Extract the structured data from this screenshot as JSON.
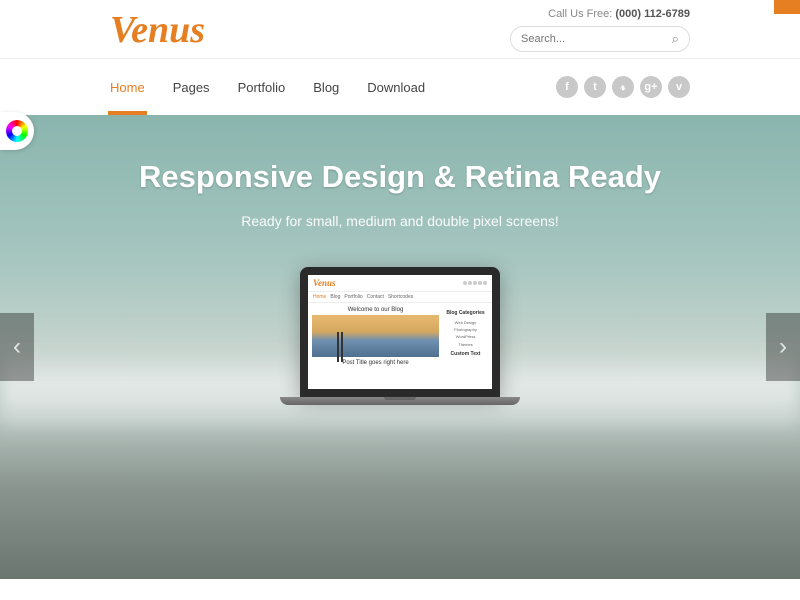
{
  "header": {
    "logo": "Venus",
    "call_label": "Call Us Free: ",
    "phone": "(000) 112-6789",
    "search_placeholder": "Search..."
  },
  "nav": {
    "items": [
      {
        "label": "Home",
        "active": true
      },
      {
        "label": "Pages",
        "active": false
      },
      {
        "label": "Portfolio",
        "active": false
      },
      {
        "label": "Blog",
        "active": false
      },
      {
        "label": "Download",
        "active": false
      }
    ],
    "social": [
      {
        "name": "facebook",
        "glyph": "f"
      },
      {
        "name": "twitter",
        "glyph": "t"
      },
      {
        "name": "rss",
        "glyph": "𝓻"
      },
      {
        "name": "gplus",
        "glyph": "g+"
      },
      {
        "name": "vimeo",
        "glyph": "v"
      }
    ]
  },
  "hero": {
    "title": "Responsive Design & Retina Ready",
    "subtitle": "Ready for small, medium and double pixel screens!"
  },
  "mini": {
    "logo": "Venus",
    "nav": [
      "Home",
      "Blog",
      "Portfolio",
      "Contact",
      "Shortcodes"
    ],
    "welcome": "Welcome to our Blog",
    "post_title": "Post Title goes right here",
    "side_h1": "Blog Categories",
    "side_items": [
      "Web Design",
      "Photography",
      "WordPress",
      "Themes"
    ],
    "side_h2": "Custom Text"
  },
  "colors": {
    "accent": "#e67e22"
  }
}
